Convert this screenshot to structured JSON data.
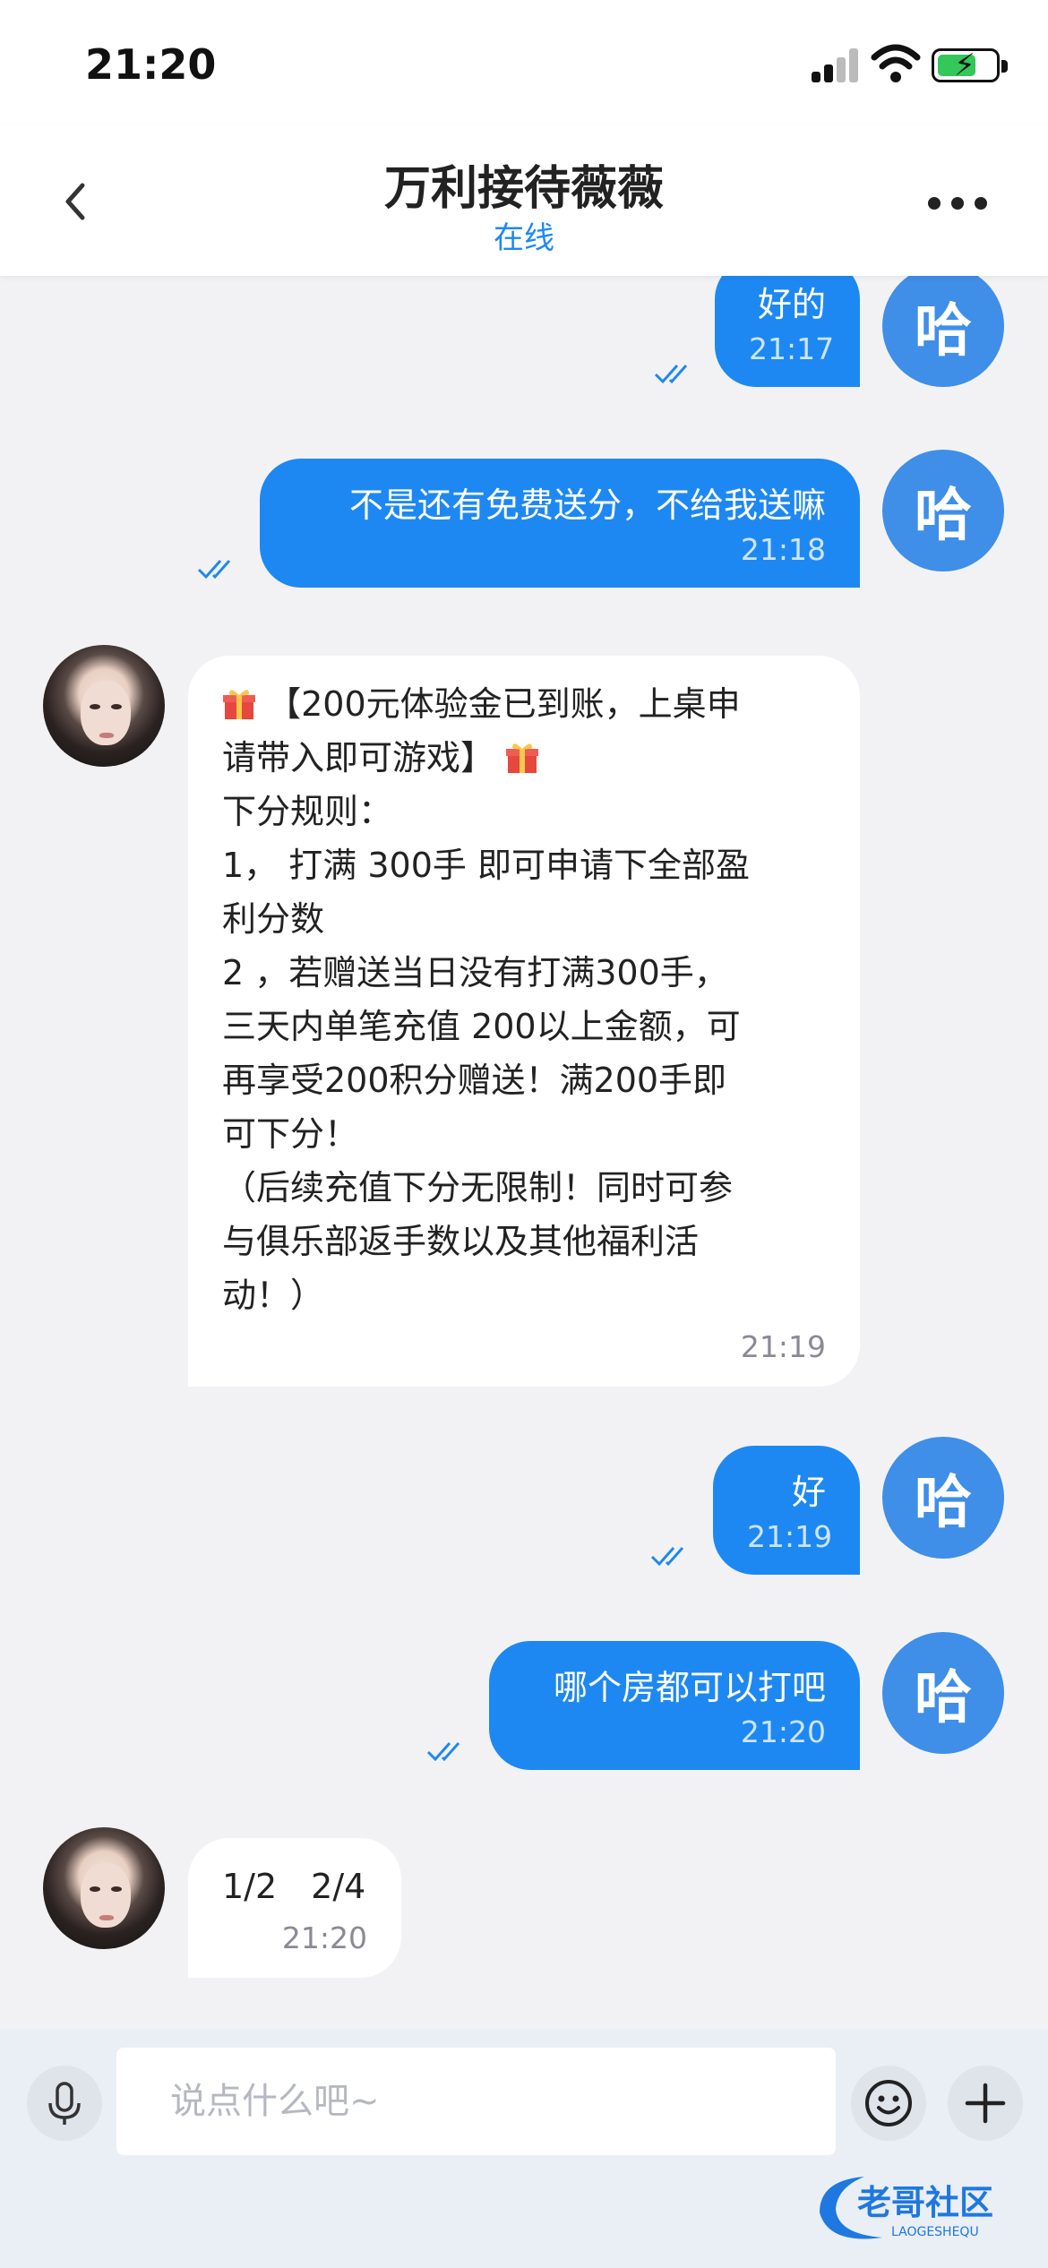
{
  "status_bar": {
    "time": "21:20"
  },
  "header": {
    "title": "万利接待薇薇",
    "status": "在线"
  },
  "me": {
    "avatar_text": "哈"
  },
  "messages": [
    {
      "from": "me",
      "text": "好的",
      "time": "21:17"
    },
    {
      "from": "me",
      "text": "不是还有免费送分，不给我送嘛",
      "time": "21:18"
    },
    {
      "from": "agent",
      "lines": [
        "【200元体验金已到账，上桌申",
        "请带入即可游戏】",
        "下分规则：",
        "1， 打满 300手 即可申请下全部盈",
        "利分数",
        "2 ，若赠送当日没有打满300手，",
        "三天内单笔充值 200以上金额，可",
        "再享受200积分赠送！满200手即",
        "可下分！",
        "（后续充值下分无限制！同时可参",
        "与俱乐部返手数以及其他福利活",
        "动！）"
      ],
      "time": "21:19"
    },
    {
      "from": "me",
      "text": "好",
      "time": "21:19"
    },
    {
      "from": "me",
      "text": "哪个房都可以打吧",
      "time": "21:20"
    },
    {
      "from": "agent",
      "text": "1/2　2/4",
      "time": "21:20"
    }
  ],
  "input": {
    "placeholder": "说点什么吧~"
  },
  "watermark": {
    "text": "老哥社区",
    "subtext": "LAOGESHEQU"
  },
  "colors": {
    "accent": "#1e88f2",
    "my_avatar": "#3f8ee8",
    "background": "#f2f2f4"
  },
  "icons": [
    "back-icon",
    "more-icon",
    "mic-icon",
    "emoji-icon",
    "plus-icon",
    "double-check-icon",
    "gift-icon"
  ]
}
